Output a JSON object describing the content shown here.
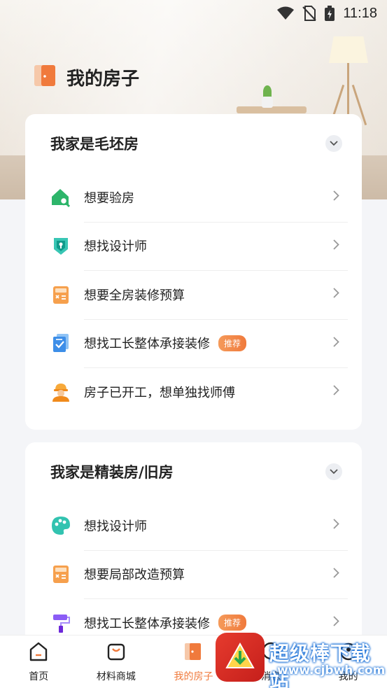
{
  "status": {
    "time": "11:18"
  },
  "page": {
    "title": "我的房子"
  },
  "sections": [
    {
      "title": "我家是毛坯房",
      "items": [
        {
          "label": "想要验房",
          "icon": "house-search-icon",
          "tag": ""
        },
        {
          "label": "想找设计师",
          "icon": "designer-icon",
          "tag": ""
        },
        {
          "label": "想要全房装修预算",
          "icon": "calculator-icon",
          "tag": ""
        },
        {
          "label": "想找工长整体承接装修",
          "icon": "contract-icon",
          "tag": "推荐"
        },
        {
          "label": "房子已开工，想单独找师傅",
          "icon": "worker-icon",
          "tag": ""
        }
      ]
    },
    {
      "title": "我家是精装房/旧房",
      "items": [
        {
          "label": "想找设计师",
          "icon": "palette-icon",
          "tag": ""
        },
        {
          "label": "想要局部改造预算",
          "icon": "calculator-icon",
          "tag": ""
        },
        {
          "label": "想找工长整体承接装修",
          "icon": "paint-roller-icon",
          "tag": "推荐"
        }
      ]
    }
  ],
  "nav": [
    {
      "label": "首页",
      "icon": "home-icon"
    },
    {
      "label": "材料商城",
      "icon": "shop-icon"
    },
    {
      "label": "我的房子",
      "icon": "door-icon",
      "active": true
    },
    {
      "label": "消息",
      "icon": "message-icon"
    },
    {
      "label": "我的",
      "icon": "profile-icon"
    }
  ],
  "watermark": {
    "text": "超级棒下载站",
    "url": "www.cjbwh.com"
  },
  "colors": {
    "accent": "#f07a3c",
    "background": "#f4f5f8"
  }
}
